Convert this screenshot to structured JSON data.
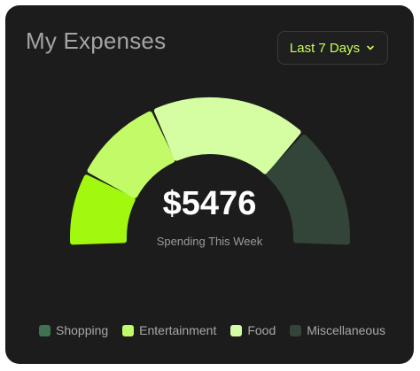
{
  "card": {
    "title": "My Expenses",
    "period": {
      "selected": "Last 7 Days",
      "icon": "chevron-down-icon"
    },
    "total": "$5476",
    "subtitle": "Spending This Week"
  },
  "chart_data": {
    "type": "pie",
    "style": "semi-donut gauge",
    "segments": [
      {
        "name": "Entertainment",
        "share": 0.16,
        "color": "#a2f80e"
      },
      {
        "name": "Food",
        "share": 0.2,
        "color": "#c2fb67"
      },
      {
        "name": "Food",
        "share": 0.36,
        "color": "#d5fea2"
      },
      {
        "name": "Miscellaneous",
        "share": 0.28,
        "color": "#334538"
      }
    ]
  },
  "legend": [
    {
      "label": "Shopping",
      "color": "#3e7250"
    },
    {
      "label": "Entertainment",
      "color": "#c0fa6a"
    },
    {
      "label": "Food",
      "color": "#d4fca6"
    },
    {
      "label": "Miscellaneous",
      "color": "#334538"
    }
  ]
}
